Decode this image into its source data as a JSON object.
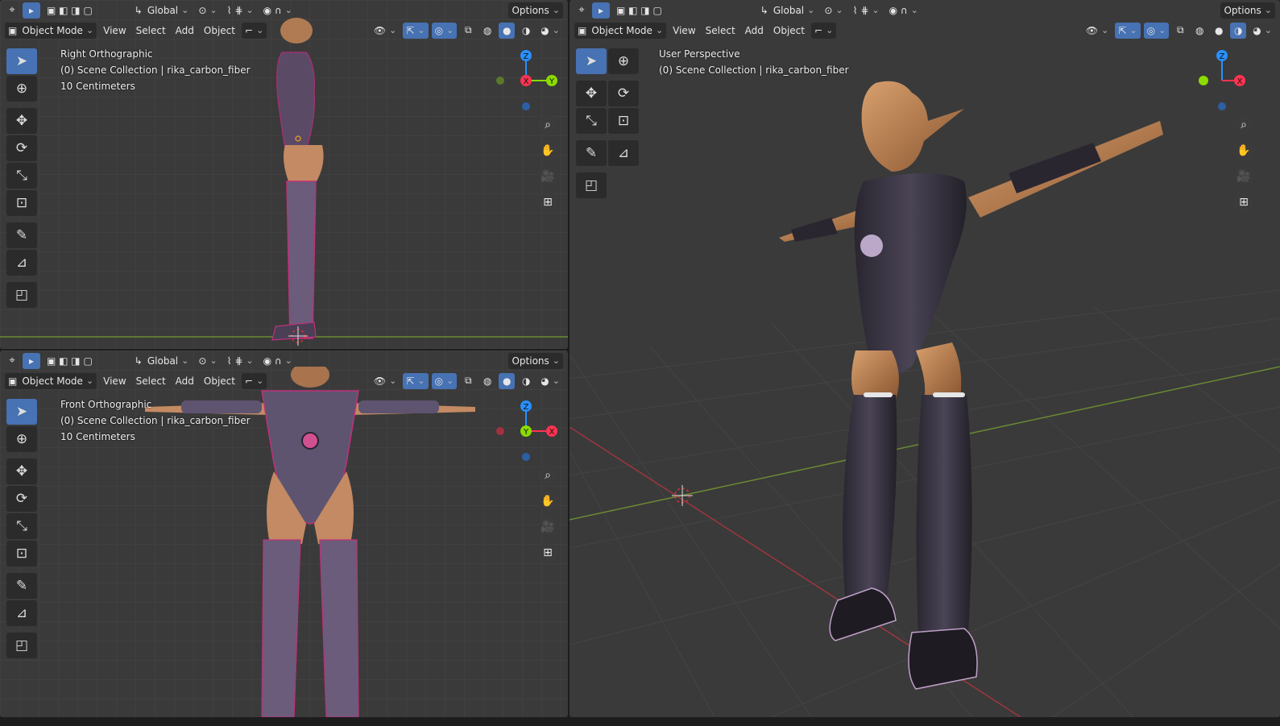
{
  "header": {
    "orientation": "Global",
    "options": "Options",
    "mode": "Object Mode",
    "menu": [
      "View",
      "Select",
      "Add",
      "Object"
    ]
  },
  "viewports": {
    "right": {
      "view": "Right Orthographic",
      "collection": "(0) Scene Collection | rika_carbon_fiber",
      "scale": "10 Centimeters"
    },
    "front": {
      "view": "Front Orthographic",
      "collection": "(0) Scene Collection | rika_carbon_fiber",
      "scale": "10 Centimeters"
    },
    "user": {
      "view": "User Perspective",
      "collection": "(0) Scene Collection | rika_carbon_fiber"
    }
  },
  "gizmo": {
    "x": "X",
    "y": "Y",
    "z": "Z"
  },
  "colors": {
    "x_axis": "#ff3352",
    "y_axis": "#8bdc00",
    "z_axis": "#2890ff",
    "active": "#4772b3",
    "bg": "#3a3a3a"
  },
  "icons": [
    "select-box-icon",
    "cursor-icon",
    "move-icon",
    "rotate-icon",
    "scale-icon",
    "transform-icon",
    "annotate-icon",
    "measure-icon",
    "add-cube-icon",
    "zoom-icon",
    "pan-icon",
    "camera-icon",
    "grid-icon"
  ]
}
